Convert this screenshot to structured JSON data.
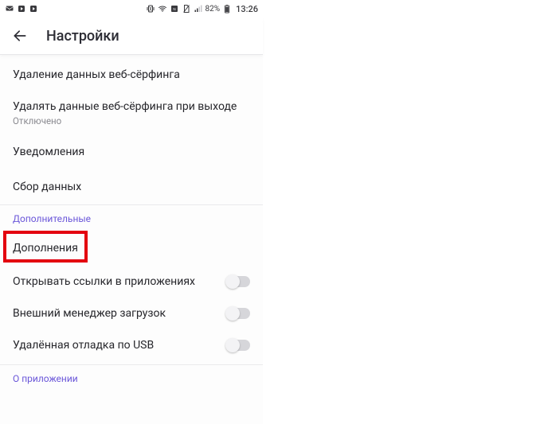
{
  "statusbar": {
    "battery_pct": "82%",
    "time": "13:26"
  },
  "header": {
    "title": "Настройки"
  },
  "rows": {
    "clear_browsing": "Удаление данных веб-сёрфинга",
    "clear_on_exit": "Удалять данные веб-сёрфинга при выходе",
    "clear_on_exit_state": "Отключено",
    "notifications": "Уведомления",
    "data_collection": "Сбор данных"
  },
  "section_additional": "Дополнительные",
  "highlight": "Дополнения",
  "toggles": {
    "open_in_apps": "Открывать ссылки в приложениях",
    "external_dm": "Внешний менеджер загрузок",
    "usb_debug": "Удалённая отладка по USB"
  },
  "section_about": "О приложении"
}
